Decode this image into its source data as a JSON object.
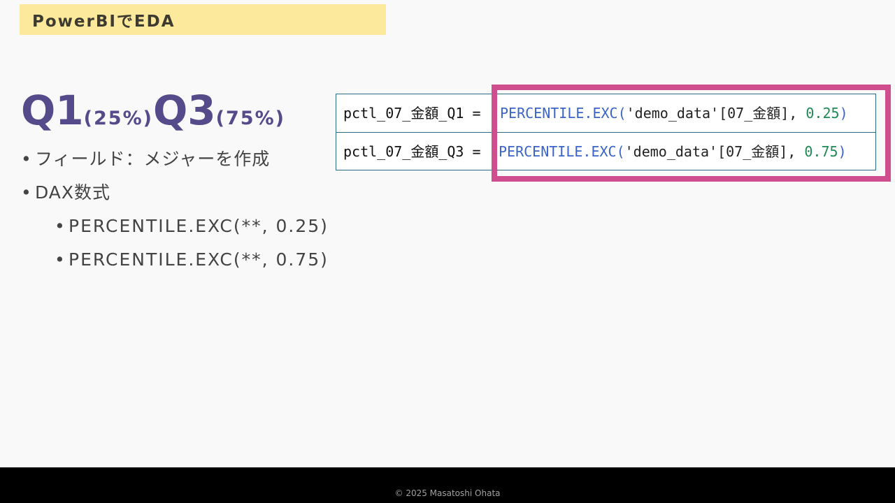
{
  "title": "PowerBIでEDA",
  "heading": {
    "q1": "Q1",
    "q1_pct": "(25%)",
    "q3": "Q3",
    "q3_pct": "(75%)"
  },
  "bullets": [
    "フィールド：メジャーを作成",
    "DAX数式"
  ],
  "sub_bullets": [
    "PERCENTILE.EXC(**, 0.25)",
    "PERCENTILE.EXC(**, 0.75)"
  ],
  "bullet_mark": "•",
  "code_rows": [
    {
      "name": "pctl_07_金額_Q1 =",
      "func": "PERCENTILE.EXC(",
      "table": "'demo_data'",
      "column": "[07_金額]",
      "sep": ", ",
      "value": "0.25",
      "close": ")"
    },
    {
      "name": "pctl_07_金額_Q3 =",
      "func": "PERCENTILE.EXC(",
      "table": "'demo_data'",
      "column": "[07_金額]",
      "sep": ", ",
      "value": "0.75",
      "close": ")"
    }
  ],
  "footer": "© 2025 Masatoshi Ohata",
  "colors": {
    "title_bg": "#fde99b",
    "heading": "#554a8a",
    "highlight": "#d14e8e",
    "table_border": "#2c6b86",
    "footer_bg": "#000000"
  }
}
